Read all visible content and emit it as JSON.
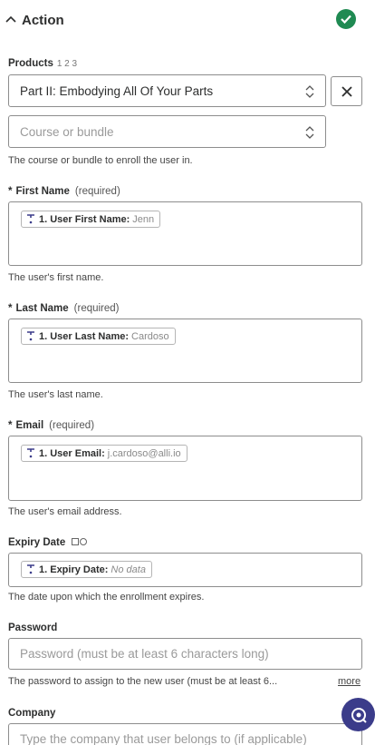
{
  "header": {
    "title": "Action",
    "status_color": "#1f8a52"
  },
  "products": {
    "label": "Products",
    "steps": "1 2 3",
    "value": "Part II: Embodying All Of Your Parts",
    "course_placeholder": "Course or bundle",
    "help": "The course or bundle to enroll the user in."
  },
  "first_name": {
    "star": "*",
    "label": "First Name",
    "required": "(required)",
    "pill_key": "1. User First Name:",
    "pill_value": "Jenn",
    "help": "The user's first name."
  },
  "last_name": {
    "star": "*",
    "label": "Last Name",
    "required": "(required)",
    "pill_key": "1. User Last Name:",
    "pill_value": "Cardoso",
    "help": "The user's last name."
  },
  "email": {
    "star": "*",
    "label": "Email",
    "required": "(required)",
    "pill_key": "1. User Email:",
    "pill_value": "j.cardoso@alli.io",
    "help": "The user's email address."
  },
  "expiry": {
    "label": "Expiry Date",
    "pill_key": "1. Expiry Date:",
    "pill_value": "No data",
    "help": "The date upon which the enrollment expires."
  },
  "password": {
    "label": "Password",
    "placeholder": "Password (must be at least 6 characters long)",
    "help": "The password to assign to the new user (must be at least 6...",
    "more": "more"
  },
  "company": {
    "label": "Company",
    "placeholder": "Type the company that user belongs to (if applicable)"
  },
  "icons": [
    "chevron-up-icon",
    "check-icon",
    "updown-icon",
    "close-icon",
    "step-icon",
    "calendar-icon",
    "support-icon"
  ],
  "accent_color": "#3b3c8a"
}
